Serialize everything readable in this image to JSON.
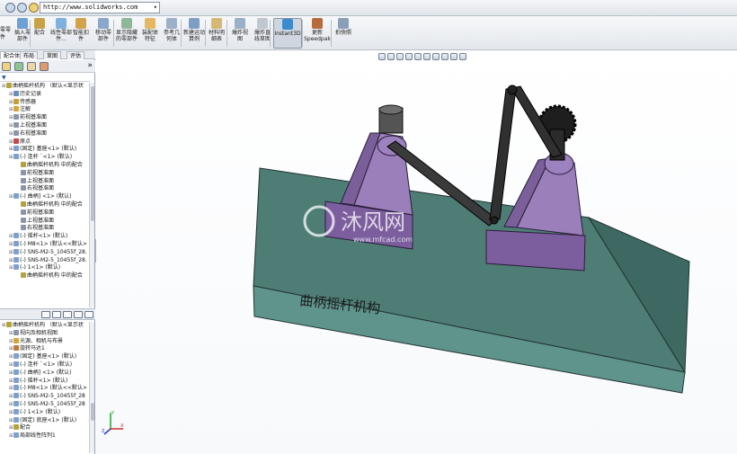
{
  "browser": {
    "url": "http://www.solidworks.com"
  },
  "toolbar": {
    "buttons": [
      {
        "label": "插入零部件"
      },
      {
        "label": "配合"
      },
      {
        "label": "线性零部件..."
      },
      {
        "label": "智能扣件"
      },
      {
        "label": "移动零部件"
      },
      {
        "label": "显示隐藏的零部件"
      },
      {
        "label": "装配体特征"
      },
      {
        "label": "参考几何体"
      },
      {
        "label": "新建运动算例"
      },
      {
        "label": "材料明细表"
      },
      {
        "label": "爆炸视图"
      },
      {
        "label": "爆炸直线草图"
      },
      {
        "label": "Instant3D"
      },
      {
        "label": "更新Speedpak"
      },
      {
        "label": "拍快照"
      }
    ],
    "left_labels": [
      "零零",
      "件"
    ]
  },
  "panel": {
    "tabs": [
      "配合体",
      "布局",
      "草图",
      "评估"
    ],
    "filter_symbol": "▼",
    "tree_top": [
      {
        "text": "曲柄摇杆机构 （默认<显示状",
        "indent": 0,
        "color": "#b3a33a"
      },
      {
        "text": "历史记录",
        "indent": 1,
        "color": "#6c8db5"
      },
      {
        "text": "传感器",
        "indent": 1,
        "color": "#c59d3a"
      },
      {
        "text": "注解",
        "indent": 1,
        "color": "#d2a63a"
      },
      {
        "text": "前视基准面",
        "indent": 1,
        "color": "#8a97a8"
      },
      {
        "text": "上视基准面",
        "indent": 1,
        "color": "#8a97a8"
      },
      {
        "text": "右视基准面",
        "indent": 1,
        "color": "#8a97a8"
      },
      {
        "text": "原点",
        "indent": 1,
        "color": "#bf4a4a"
      },
      {
        "text": "(固定) 基座<1> (默认)",
        "indent": 1,
        "color": "#7fa0c8"
      },
      {
        "text": "(-) 连杆 `<1> (默认)",
        "indent": 1,
        "color": "#7fa0c8"
      },
      {
        "text": "曲柄摇杆机构 中的配合",
        "indent": 2,
        "color": "#b3a33a"
      },
      {
        "text": "前视基准面",
        "indent": 2,
        "color": "#8a97a8"
      },
      {
        "text": "上视基准面",
        "indent": 2,
        "color": "#8a97a8"
      },
      {
        "text": "右视基准面",
        "indent": 2,
        "color": "#8a97a8"
      },
      {
        "text": "(-) 曲柄] <1> (默认)",
        "indent": 1,
        "color": "#7fa0c8"
      },
      {
        "text": "曲柄摇杆机构 中的配合",
        "indent": 2,
        "color": "#b3a33a"
      },
      {
        "text": "前视基准面",
        "indent": 2,
        "color": "#8a97a8"
      },
      {
        "text": "上视基准面",
        "indent": 2,
        "color": "#8a97a8"
      },
      {
        "text": "右视基准面",
        "indent": 2,
        "color": "#8a97a8"
      },
      {
        "text": "(-) 摇杆<1> (默认)",
        "indent": 1,
        "color": "#7fa0c8"
      },
      {
        "text": "(-) M8<1> (默认<<默认>",
        "indent": 1,
        "color": "#7fa0c8"
      },
      {
        "text": "(-) SNS-M2-5_10455f_28.",
        "indent": 1,
        "color": "#7fa0c8"
      },
      {
        "text": "(-) SNS-M2-5_10455f_28.",
        "indent": 1,
        "color": "#7fa0c8"
      },
      {
        "text": "(-) 1<1> (默认)",
        "indent": 1,
        "color": "#7fa0c8"
      },
      {
        "text": "曲柄摇杆机构 中的配合",
        "indent": 2,
        "color": "#b3a33a"
      }
    ],
    "tree_bottom": [
      {
        "text": "曲柄摇杆机构 （默认<显示状",
        "indent": 0,
        "color": "#b3a33a"
      },
      {
        "text": "视向及相机视图",
        "indent": 1,
        "color": "#8a97a8"
      },
      {
        "text": "光源、相机与布景",
        "indent": 1,
        "color": "#d2a63a"
      },
      {
        "text": "旋转马达1",
        "indent": 1,
        "color": "#c07a3a"
      },
      {
        "text": "(固定) 基座<1> (默认)",
        "indent": 1,
        "color": "#7fa0c8"
      },
      {
        "text": "(-) 连杆 `<1> (默认)",
        "indent": 1,
        "color": "#7fa0c8"
      },
      {
        "text": "(-) 曲柄] <1> (默认)",
        "indent": 1,
        "color": "#7fa0c8"
      },
      {
        "text": "(-) 摇杆<1> (默认)",
        "indent": 1,
        "color": "#7fa0c8"
      },
      {
        "text": "(-) M8<1> (默认<<默认>",
        "indent": 1,
        "color": "#7fa0c8"
      },
      {
        "text": "(-) SNS-M2-5_10455f_28",
        "indent": 1,
        "color": "#7fa0c8"
      },
      {
        "text": "(-) SNS-M2-5_10455f_28",
        "indent": 1,
        "color": "#7fa0c8"
      },
      {
        "text": "(-) 1<1> (默认)",
        "indent": 1,
        "color": "#7fa0c8"
      },
      {
        "text": "(固定) 底座<1> (默认)",
        "indent": 1,
        "color": "#7fa0c8"
      },
      {
        "text": "配合",
        "indent": 1,
        "color": "#b3a33a"
      },
      {
        "text": "局部线性阵列1",
        "indent": 1,
        "color": "#7fa0c8"
      }
    ]
  },
  "viewport": {
    "model_label": "曲柄摇杆机构",
    "watermark_text": "沐风网",
    "watermark_url": "www.mfcad.com",
    "triad_axes": {
      "x": "X",
      "y": "Y",
      "z": "Z"
    }
  },
  "colors": {
    "base_block": "#5a8a80",
    "base_block_top": "#4a7670",
    "support_purple": "#8c6fae",
    "link_dark": "#2a2a2a",
    "knob_black": "#1a1a1a"
  }
}
